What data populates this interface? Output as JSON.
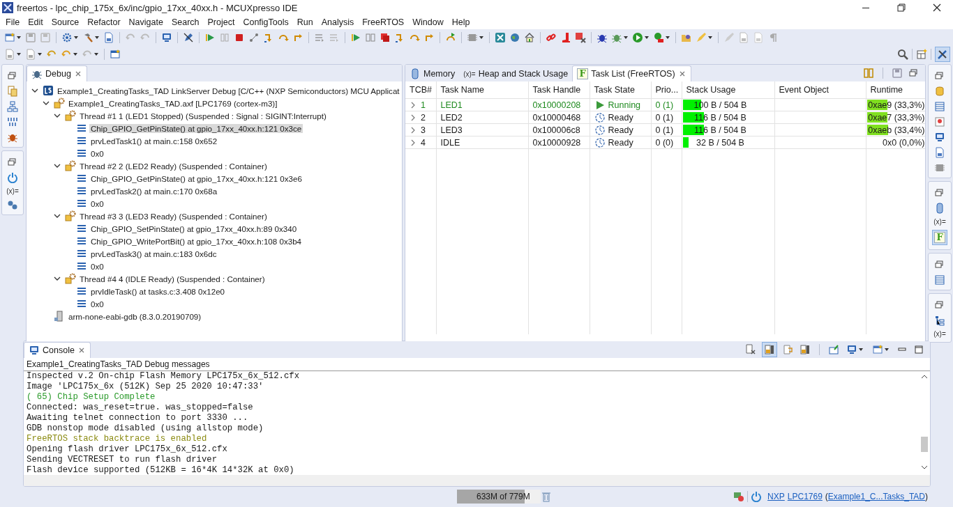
{
  "window": {
    "title": "freertos - lpc_chip_175x_6x/inc/gpio_17xx_40xx.h - MCUXpresso IDE"
  },
  "menu": [
    "File",
    "Edit",
    "Source",
    "Refactor",
    "Navigate",
    "Search",
    "Project",
    "ConfigTools",
    "Run",
    "Analysis",
    "FreeRTOS",
    "Window",
    "Help"
  ],
  "left_trim": {
    "glyph": "(x)="
  },
  "right_trim": {
    "glyphs": [
      "(x)=",
      "F",
      "(x)="
    ]
  },
  "debug_view": {
    "tab": "Debug",
    "tree": [
      {
        "kind": "launch",
        "label": "Example1_CreatingTasks_TAD LinkServer Debug [C/C++ (NXP Semiconductors) MCU Applicat",
        "expanded": true,
        "selected": false,
        "children": [
          {
            "kind": "process",
            "label": "Example1_CreatingTasks_TAD.axf [LPC1769 (cortex-m3)]",
            "expanded": true,
            "selected": false,
            "children": [
              {
                "kind": "thread",
                "label": "Thread #1 1 (LED1 Stopped) (Suspended : Signal : SIGINT:Interrupt)",
                "expanded": true,
                "selected": false,
                "children": [
                  {
                    "kind": "frame",
                    "label": "Chip_GPIO_GetPinState() at gpio_17xx_40xx.h:121 0x3ce",
                    "selected": true
                  },
                  {
                    "kind": "frame",
                    "label": "prvLedTask1() at main.c:158 0x652",
                    "selected": false
                  },
                  {
                    "kind": "frame",
                    "label": "0x0",
                    "selected": false
                  }
                ]
              },
              {
                "kind": "thread",
                "label": "Thread #2 2 (LED2 Ready) (Suspended : Container)",
                "expanded": true,
                "selected": false,
                "children": [
                  {
                    "kind": "frame",
                    "label": "Chip_GPIO_GetPinState() at gpio_17xx_40xx.h:121 0x3e6",
                    "selected": false
                  },
                  {
                    "kind": "frame",
                    "label": "prvLedTask2() at main.c:170 0x68a",
                    "selected": false
                  },
                  {
                    "kind": "frame",
                    "label": "0x0",
                    "selected": false
                  }
                ]
              },
              {
                "kind": "thread",
                "label": "Thread #3 3 (LED3 Ready) (Suspended : Container)",
                "expanded": true,
                "selected": false,
                "children": [
                  {
                    "kind": "frame",
                    "label": "Chip_GPIO_SetPinState() at gpio_17xx_40xx.h:89 0x340",
                    "selected": false
                  },
                  {
                    "kind": "frame",
                    "label": "Chip_GPIO_WritePortBit() at gpio_17xx_40xx.h:108 0x3b4",
                    "selected": false
                  },
                  {
                    "kind": "frame",
                    "label": "prvLedTask3() at main.c:183 0x6dc",
                    "selected": false
                  },
                  {
                    "kind": "frame",
                    "label": "0x0",
                    "selected": false
                  }
                ]
              },
              {
                "kind": "thread",
                "label": "Thread #4 4 (IDLE Ready) (Suspended : Container)",
                "expanded": true,
                "selected": false,
                "children": [
                  {
                    "kind": "frame",
                    "label": "prvIdleTask() at tasks.c:3.408 0x12e0",
                    "selected": false
                  },
                  {
                    "kind": "frame",
                    "label": "0x0",
                    "selected": false
                  }
                ]
              }
            ]
          },
          {
            "kind": "gdb",
            "label": "arm-none-eabi-gdb (8.3.0.20190709)",
            "selected": false
          }
        ]
      }
    ]
  },
  "task_view": {
    "tabs": [
      {
        "kind": "memory",
        "label": "Memory",
        "selected": false
      },
      {
        "kind": "glyph",
        "glyph": "(x)=",
        "label": "Heap and Stack Usage",
        "selected": false
      },
      {
        "kind": "glyph",
        "glyph": "F",
        "label": "Task List (FreeRTOS)",
        "selected": true
      }
    ],
    "columns": [
      "TCB#",
      "Task Name",
      "Task Handle",
      "Task State",
      "Prio...",
      "Stack Usage",
      "Event Object",
      "Runtime"
    ],
    "rows": [
      {
        "tcb": "1",
        "name": "LED1",
        "handle": "0x10000208",
        "state": {
          "kind": "running",
          "label": "Running"
        },
        "priority": "0 (1)",
        "stack": {
          "level": 0.198,
          "text": "100 B / 504 B"
        },
        "runtime": {
          "level": 0.333,
          "text": "0xae9 (33,3%)"
        }
      },
      {
        "tcb": "2",
        "name": "LED2",
        "handle": "0x10000468",
        "state": {
          "kind": "ready",
          "label": "Ready"
        },
        "priority": "0 (1)",
        "stack": {
          "level": 0.23,
          "text": "116 B / 504 B"
        },
        "runtime": {
          "level": 0.333,
          "text": "0xae7 (33,3%)"
        }
      },
      {
        "tcb": "3",
        "name": "LED3",
        "handle": "0x100006c8",
        "state": {
          "kind": "ready",
          "label": "Ready"
        },
        "priority": "0 (1)",
        "stack": {
          "level": 0.23,
          "text": "116 B / 504 B"
        },
        "runtime": {
          "level": 0.334,
          "text": "0xaeb (33,4%)"
        }
      },
      {
        "tcb": "4",
        "name": "IDLE",
        "handle": "0x10000928",
        "state": {
          "kind": "ready",
          "label": "Ready"
        },
        "priority": "0 (0)",
        "stack": {
          "level": 0.063,
          "text": "32 B / 504 B"
        },
        "runtime": {
          "level": 0.0,
          "text": "0x0 (0,0%)"
        }
      }
    ]
  },
  "console": {
    "tab": "Console",
    "header": "Example1_CreatingTasks_TAD Debug messages",
    "lines": [
      {
        "kind": "normal",
        "text": "Inspected v.2 On-chip Flash Memory LPC175x_6x_512.cfx"
      },
      {
        "kind": "normal",
        "text": "Image 'LPC175x_6x (512K) Sep 25 2020 10:47:33'"
      },
      {
        "kind": "success",
        "text": "( 65) Chip Setup Complete"
      },
      {
        "kind": "normal",
        "text": "Connected: was_reset=true. was_stopped=false"
      },
      {
        "kind": "normal",
        "text": "Awaiting telnet connection to port 3330 ..."
      },
      {
        "kind": "normal",
        "text": "GDB nonstop mode disabled (using allstop mode)"
      },
      {
        "kind": "notice",
        "text": "FreeRTOS stack backtrace is enabled"
      },
      {
        "kind": "normal",
        "text": "Opening flash driver LPC175x_6x_512.cfx"
      },
      {
        "kind": "normal",
        "text": "Sending VECTRESET to run flash driver"
      },
      {
        "kind": "normal",
        "text": "Flash device supported (512KB = 16*4K 14*32K at 0x0)"
      }
    ]
  },
  "status_bar": {
    "memory": "633M of 779M",
    "level": 0.81,
    "links": [
      "NXP",
      "LPC1769",
      "Example1_C...Tasks_TAD"
    ],
    "prefix": "(",
    "suffix": ")"
  }
}
